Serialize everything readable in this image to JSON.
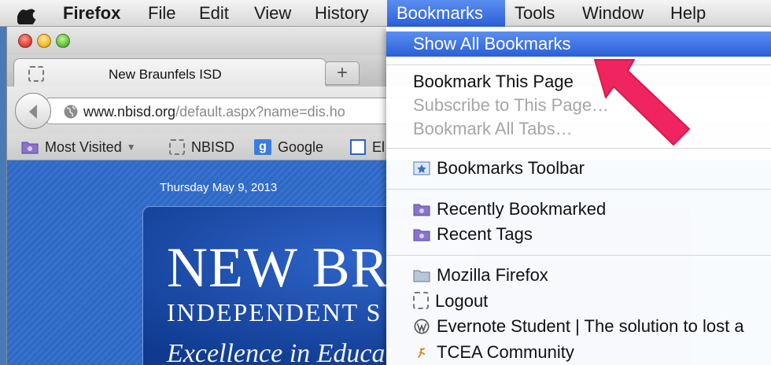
{
  "menubar": {
    "app": "Firefox",
    "items": [
      "File",
      "Edit",
      "View",
      "History",
      "Bookmarks",
      "Tools",
      "Window",
      "Help"
    ],
    "active": "Bookmarks"
  },
  "window": {
    "tab_title": "New Braunfels ISD",
    "new_tab": "+",
    "url_host": "www.nbisd.org",
    "url_path": "/default.aspx?name=dis.ho"
  },
  "bookmarks_toolbar": {
    "items": [
      "Most Visited",
      "NBISD",
      "Google",
      "El"
    ]
  },
  "page": {
    "date": "Thursday May 9, 2013",
    "banner_title": "NEW BR",
    "banner_subtitle": "INDEPENDENT S",
    "banner_motto": "Excellence in Educat"
  },
  "bookmarks_menu": {
    "show_all": "Show All Bookmarks",
    "bookmark_page": "Bookmark This Page",
    "subscribe": "Subscribe to This Page…",
    "bookmark_all_tabs": "Bookmark All Tabs…",
    "toolbar": "Bookmarks Toolbar",
    "recently_bookmarked": "Recently Bookmarked",
    "recent_tags": "Recent Tags",
    "mozilla": "Mozilla Firefox",
    "logout": "Logout",
    "evernote": "Evernote Student | The solution to lost a",
    "tcea": "TCEA Community"
  },
  "colors": {
    "highlight": "#2a5fd8",
    "annotation_arrow": "#f0245e"
  }
}
